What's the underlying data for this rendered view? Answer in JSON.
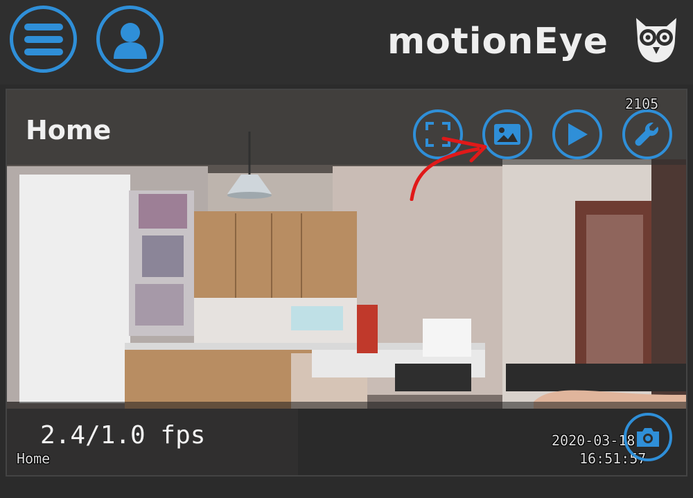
{
  "app": {
    "title": "motionEye"
  },
  "camera": {
    "name": "Home",
    "fps": "2.4/1.0 fps",
    "overlay_corner_top": "2105",
    "overlay_label": "Home",
    "overlay_date": "2020-03-18",
    "overlay_time": "16:51:57"
  },
  "icons": {
    "menu": "menu-icon",
    "user": "user-icon",
    "logo": "owl-logo",
    "fullscreen": "fullscreen-icon",
    "pictures": "pictures-icon",
    "movies": "play-icon",
    "settings": "wrench-icon",
    "snapshot": "camera-icon"
  },
  "colors": {
    "accent": "#2f8fd8",
    "topbar": "#2f2f2f",
    "annotation_arrow": "#e01919"
  }
}
